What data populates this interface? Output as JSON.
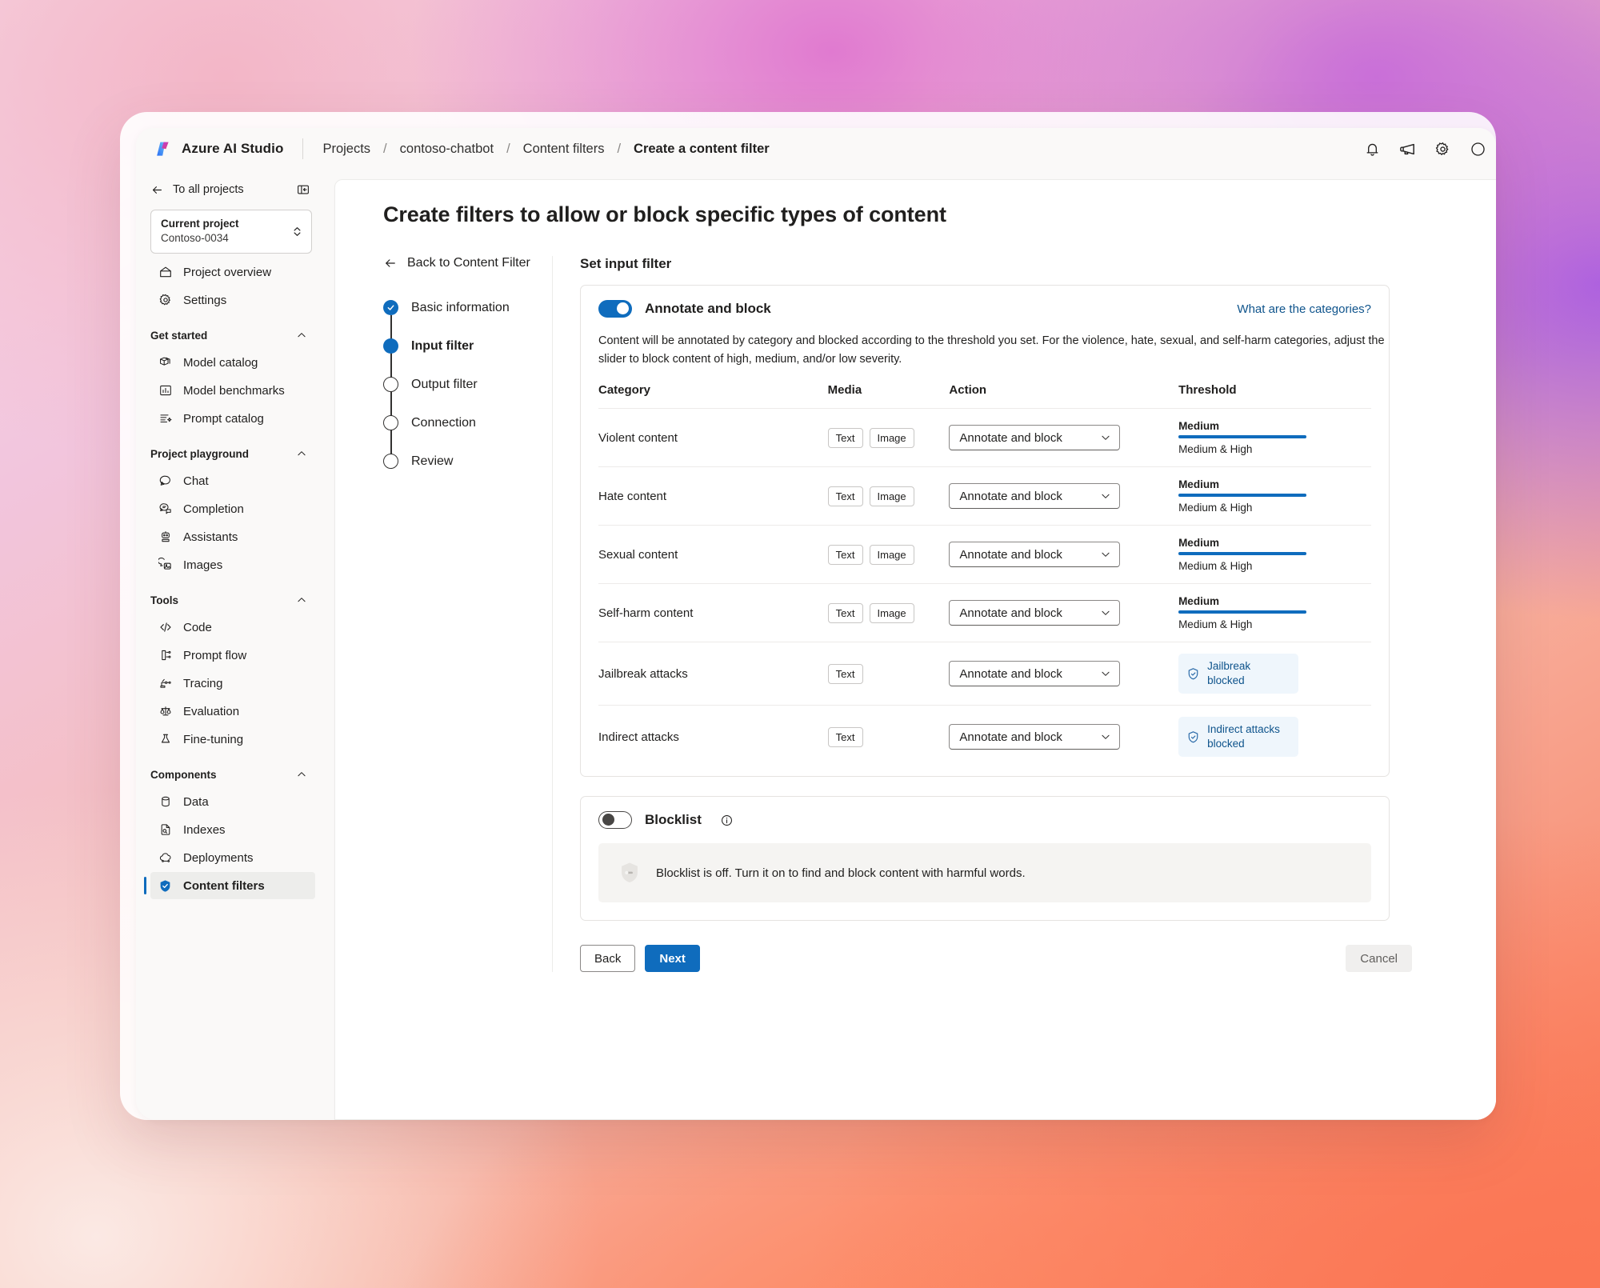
{
  "topbar": {
    "brand": "Azure AI Studio",
    "logo_icon": "azure-ai-studio-logo",
    "breadcrumbs": [
      "Projects",
      "contoso-chatbot",
      "Content filters",
      "Create a content filter"
    ],
    "separator": "/",
    "icons": [
      "bell-icon",
      "announcement-icon",
      "gear-icon",
      "help-icon"
    ]
  },
  "sidebar": {
    "back_label": "To all projects",
    "back_icon": "arrow-left-icon",
    "collapse_icon": "collapse-panel-icon",
    "project": {
      "title": "Current project",
      "name": "Contoso-0034",
      "chevron_icon": "chevron-up-down-icon"
    },
    "top_items": [
      {
        "label": "Project overview",
        "icon": "home-icon"
      },
      {
        "label": "Settings",
        "icon": "gear-icon"
      }
    ],
    "groups": [
      {
        "title": "Get started",
        "chevron_icon": "chevron-up-icon",
        "items": [
          {
            "label": "Model catalog",
            "icon": "cube-icon"
          },
          {
            "label": "Model benchmarks",
            "icon": "bar-chart-icon"
          },
          {
            "label": "Prompt catalog",
            "icon": "prompt-list-icon"
          }
        ]
      },
      {
        "title": "Project playground",
        "chevron_icon": "chevron-up-icon",
        "items": [
          {
            "label": "Chat",
            "icon": "chat-bubble-icon"
          },
          {
            "label": "Completion",
            "icon": "completion-icon"
          },
          {
            "label": "Assistants",
            "icon": "robot-icon"
          },
          {
            "label": "Images",
            "icon": "image-bubble-icon"
          }
        ]
      },
      {
        "title": "Tools",
        "chevron_icon": "chevron-up-icon",
        "items": [
          {
            "label": "Code",
            "icon": "code-icon"
          },
          {
            "label": "Prompt flow",
            "icon": "prompt-flow-icon"
          },
          {
            "label": "Tracing",
            "icon": "tracing-icon"
          },
          {
            "label": "Evaluation",
            "icon": "scales-icon"
          },
          {
            "label": "Fine-tuning",
            "icon": "flask-icon"
          }
        ]
      },
      {
        "title": "Components",
        "chevron_icon": "chevron-up-icon",
        "items": [
          {
            "label": "Data",
            "icon": "database-icon"
          },
          {
            "label": "Indexes",
            "icon": "document-search-icon"
          },
          {
            "label": "Deployments",
            "icon": "cloud-icon"
          },
          {
            "label": "Content filters",
            "icon": "shield-check-icon",
            "selected": true
          }
        ]
      }
    ]
  },
  "page": {
    "title": "Create filters to allow or block specific types of content",
    "back_link": "Back to Content Filter",
    "back_icon": "arrow-left-icon",
    "steps": [
      {
        "label": "Basic information",
        "state": "done"
      },
      {
        "label": "Input filter",
        "state": "current"
      },
      {
        "label": "Output filter",
        "state": "todo"
      },
      {
        "label": "Connection",
        "state": "todo"
      },
      {
        "label": "Review",
        "state": "todo"
      }
    ],
    "section_title": "Set input filter"
  },
  "filter_panel": {
    "toggle_label": "Annotate and block",
    "toggle_state": "on",
    "help_link": "What are the categories?",
    "description": "Content will be annotated by category and blocked according to the threshold you set. For the violence, hate, sexual, and self-harm categories, adjust the slider to block content of high, medium, and/or low severity.",
    "columns": [
      "Category",
      "Media",
      "Action",
      "Threshold"
    ],
    "rows": [
      {
        "category": "Violent content",
        "media": [
          "Text",
          "Image"
        ],
        "action": "Annotate and block",
        "threshold_kind": "slider",
        "threshold_top": "Medium",
        "threshold_bottom": "Medium & High",
        "threshold_fill_pct": 100
      },
      {
        "category": "Hate content",
        "media": [
          "Text",
          "Image"
        ],
        "action": "Annotate and block",
        "threshold_kind": "slider",
        "threshold_top": "Medium",
        "threshold_bottom": "Medium & High",
        "threshold_fill_pct": 100
      },
      {
        "category": "Sexual content",
        "media": [
          "Text",
          "Image"
        ],
        "action": "Annotate and block",
        "threshold_kind": "slider",
        "threshold_top": "Medium",
        "threshold_bottom": "Medium & High",
        "threshold_fill_pct": 100
      },
      {
        "category": "Self-harm content",
        "media": [
          "Text",
          "Image"
        ],
        "action": "Annotate and block",
        "threshold_kind": "slider",
        "threshold_top": "Medium",
        "threshold_bottom": "Medium & High",
        "threshold_fill_pct": 100
      },
      {
        "category": "Jailbreak attacks",
        "media": [
          "Text"
        ],
        "action": "Annotate and block",
        "threshold_kind": "pill",
        "threshold_pill": "Jailbreak blocked",
        "threshold_pill_icon": "shield-check-icon"
      },
      {
        "category": "Indirect attacks",
        "media": [
          "Text"
        ],
        "action": "Annotate and block",
        "threshold_kind": "pill",
        "threshold_pill": "Indirect attacks blocked",
        "threshold_pill_icon": "shield-check-icon"
      }
    ],
    "action_chevron_icon": "chevron-down-icon"
  },
  "blocklist_panel": {
    "toggle_label": "Blocklist",
    "toggle_state": "off",
    "info_icon": "info-icon",
    "empty_icon": "shield-empty-icon",
    "empty_message": "Blocklist is off. Turn it on to find and block content with harmful words."
  },
  "footer": {
    "back_label": "Back",
    "next_label": "Next",
    "cancel_label": "Cancel"
  },
  "colors": {
    "accent": "#0f6cbd",
    "link": "#0f548c",
    "pill_bg": "#eff6fc",
    "surface": "#faf9f8"
  }
}
